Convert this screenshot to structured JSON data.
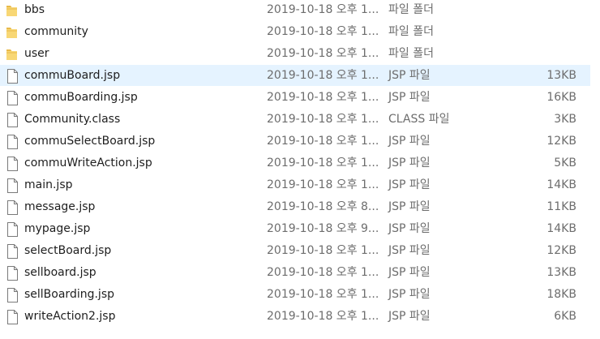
{
  "files": [
    {
      "name": "bbs",
      "date": "2019-10-18 오후 1...",
      "type": "파일 폴더",
      "size": "",
      "icon": "folder-icon",
      "selected": false
    },
    {
      "name": "community",
      "date": "2019-10-18 오후 1...",
      "type": "파일 폴더",
      "size": "",
      "icon": "folder-icon",
      "selected": false
    },
    {
      "name": "user",
      "date": "2019-10-18 오후 1...",
      "type": "파일 폴더",
      "size": "",
      "icon": "folder-icon",
      "selected": false
    },
    {
      "name": "commuBoard.jsp",
      "date": "2019-10-18 오후 1...",
      "type": "JSP 파일",
      "size": "13KB",
      "icon": "file-icon",
      "selected": true
    },
    {
      "name": "commuBoarding.jsp",
      "date": "2019-10-18 오후 1...",
      "type": "JSP 파일",
      "size": "16KB",
      "icon": "file-icon",
      "selected": false
    },
    {
      "name": "Community.class",
      "date": "2019-10-18 오후 1...",
      "type": "CLASS 파일",
      "size": "3KB",
      "icon": "file-icon",
      "selected": false
    },
    {
      "name": "commuSelectBoard.jsp",
      "date": "2019-10-18 오후 1...",
      "type": "JSP 파일",
      "size": "12KB",
      "icon": "file-icon",
      "selected": false
    },
    {
      "name": "commuWriteAction.jsp",
      "date": "2019-10-18 오후 1...",
      "type": "JSP 파일",
      "size": "5KB",
      "icon": "file-icon",
      "selected": false
    },
    {
      "name": "main.jsp",
      "date": "2019-10-18 오후 1...",
      "type": "JSP 파일",
      "size": "14KB",
      "icon": "file-icon",
      "selected": false
    },
    {
      "name": "message.jsp",
      "date": "2019-10-18 오후 8...",
      "type": "JSP 파일",
      "size": "11KB",
      "icon": "file-icon",
      "selected": false
    },
    {
      "name": "mypage.jsp",
      "date": "2019-10-18 오후 9...",
      "type": "JSP 파일",
      "size": "14KB",
      "icon": "file-icon",
      "selected": false
    },
    {
      "name": "selectBoard.jsp",
      "date": "2019-10-18 오후 1...",
      "type": "JSP 파일",
      "size": "12KB",
      "icon": "file-icon",
      "selected": false
    },
    {
      "name": "sellboard.jsp",
      "date": "2019-10-18 오후 1...",
      "type": "JSP 파일",
      "size": "13KB",
      "icon": "file-icon",
      "selected": false
    },
    {
      "name": "sellBoarding.jsp",
      "date": "2019-10-18 오후 1...",
      "type": "JSP 파일",
      "size": "18KB",
      "icon": "file-icon",
      "selected": false
    },
    {
      "name": "writeAction2.jsp",
      "date": "2019-10-18 오후 1...",
      "type": "JSP 파일",
      "size": "6KB",
      "icon": "file-icon",
      "selected": false
    }
  ],
  "colors": {
    "folder": "#f8d775",
    "folder_dark": "#e8b94a",
    "selection": "#e5f3ff",
    "file_outline": "#7a7a7a"
  }
}
